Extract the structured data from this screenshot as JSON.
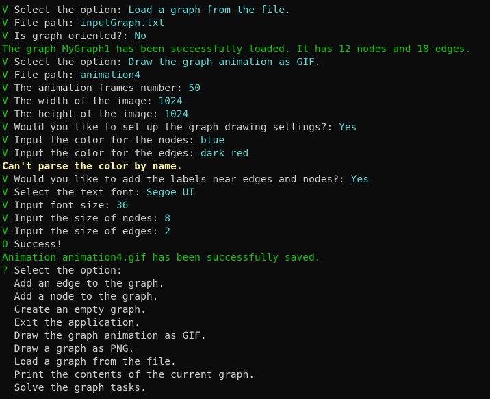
{
  "lines": [
    {
      "marker": "V",
      "prompt": "Select the option:",
      "answer": "Load a graph from the file."
    },
    {
      "marker": "V",
      "prompt": "File path:",
      "answer": "inputGraph.txt"
    },
    {
      "marker": "V",
      "prompt": "Is graph oriented?:",
      "answer": "No"
    },
    {
      "message": "The graph MyGraph1 has been successfully loaded. It has 12 nodes and 18 edges."
    },
    {
      "marker": "V",
      "prompt": "Select the option:",
      "answer": "Draw the graph animation as GIF."
    },
    {
      "marker": "V",
      "prompt": "File path:",
      "answer": "animation4"
    },
    {
      "marker": "V",
      "prompt": "The animation frames number:",
      "answer": "50"
    },
    {
      "marker": "V",
      "prompt": "The width of the image:",
      "answer": "1024"
    },
    {
      "marker": "V",
      "prompt": "The height of the image:",
      "answer": "1024"
    },
    {
      "marker": "V",
      "prompt": "Would you like to set up the graph drawing settings?:",
      "answer": "Yes"
    },
    {
      "marker": "V",
      "prompt": "Input the color for the nodes:",
      "answer": "blue"
    },
    {
      "marker": "V",
      "prompt": "Input the color for the edges:",
      "answer": "dark red"
    },
    {
      "warning": "Can't parse the color by name."
    },
    {
      "marker": "V",
      "prompt": "Would you like to add the labels near edges and nodes?:",
      "answer": "Yes"
    },
    {
      "marker": "V",
      "prompt": "Select the text font:",
      "answer": "Segoe UI"
    },
    {
      "marker": "V",
      "prompt": "Input font size:",
      "answer": "36"
    },
    {
      "marker": "V",
      "prompt": "Input the size of nodes:",
      "answer": "8"
    },
    {
      "marker": "V",
      "prompt": "Input the size of edges:",
      "answer": "2"
    },
    {
      "marker": "O",
      "prompt": "Success!"
    },
    {
      "message": "Animation animation4.gif has been successfully saved."
    },
    {
      "marker": "?",
      "prompt": "Select the option:"
    }
  ],
  "menu": [
    "Add an edge to the graph.",
    "Add a node to the graph.",
    "Create an empty graph.",
    "Exit the application.",
    "Draw the graph animation as GIF.",
    "Draw a graph as PNG.",
    "Load a graph from the file.",
    "Print the contents of the current graph.",
    "Solve the graph tasks."
  ],
  "colors": {
    "background": "#0c0c0c",
    "marker": "#16c60c",
    "text": "#cccccc",
    "answer": "#61d6d6",
    "success": "#16c60c",
    "warning": "#f9f1a5"
  }
}
